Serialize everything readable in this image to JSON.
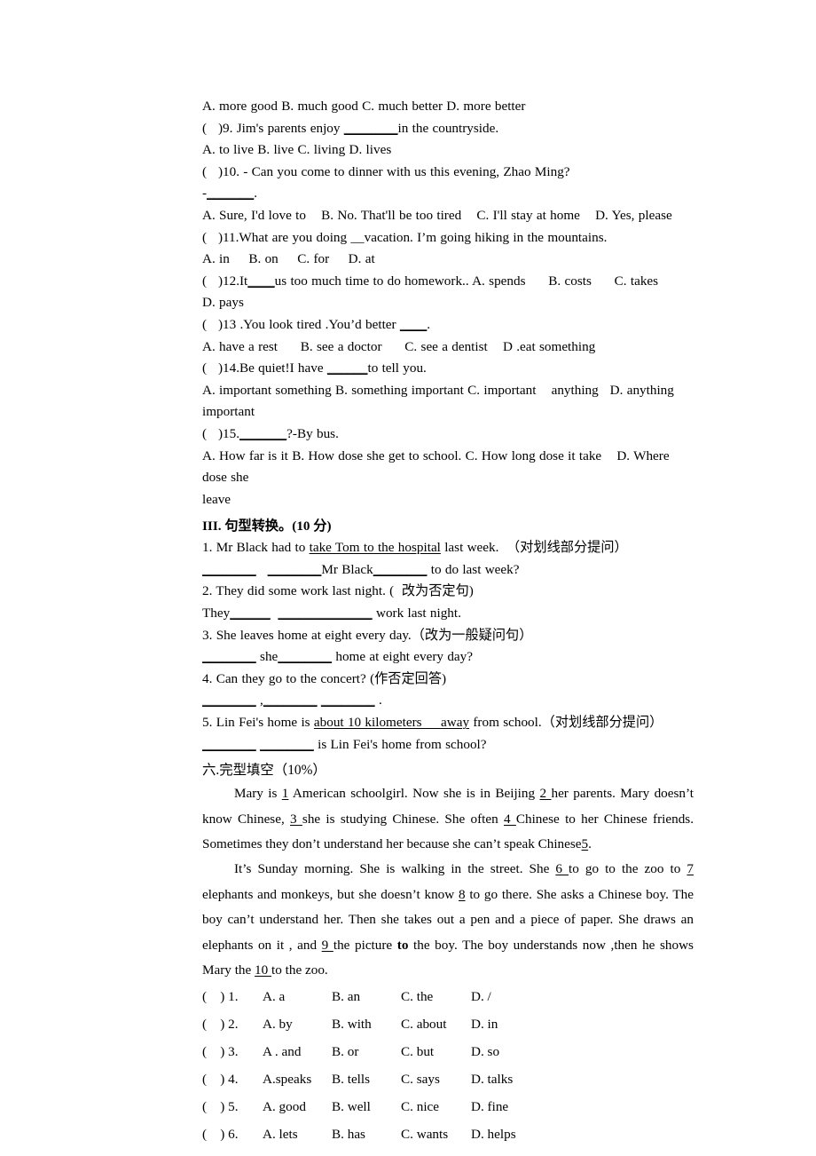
{
  "document": {
    "type": "english-exam-paper"
  },
  "multiple_choice": {
    "lines": [
      "A. more good B. much good C. much better D. more better",
      "(   )9. Jim's parents enjoy ",
      "in the countryside.",
      "A. to live B. live C. living D. lives",
      "(   )10. - Can you come to dinner with us this evening, Zhao Ming?",
      "-",
      ".",
      "A. Sure, I'd love to    B. No. That'll be too tired    C. I'll stay at home    D. Yes, please",
      "(   )11.What are you doing __vacation. I’m going hiking in the mountains.",
      "A. in     B. on     C. for     D. at",
      "(   )12.It",
      "us too much time to do homework.. A. spends      B. costs      C. takes      D. pays",
      "(   )13 .You look tired .You’d better ",
      ".",
      "A. have a rest      B. see a doctor      C. see a dentist    D .eat something",
      "(   )14.Be quiet!I have ",
      "to tell you.",
      "A. important something B. something important C. important    anything   D. anything important",
      "(   )15.",
      "?-By bus.",
      "A. How far is it B. How dose she get to school. C. How long dose it take    D. Where dose she",
      "leave"
    ],
    "q9": {
      "prefix": "(   )9. Jim's parents enjoy ",
      "blank": "________",
      "suffix": "in the countryside."
    },
    "q9_options": "A. to live B. live C. living D. lives",
    "q10": "(   )10. - Can you come to dinner with us this evening, Zhao Ming?",
    "q10_answer_line_prefix": "-",
    "q10_answer_line_blank": "_______",
    "q10_answer_line_suffix": ".",
    "q10_options": "A. Sure, I'd love to    B. No. That'll be too tired    C. I'll stay at home    D. Yes, please",
    "q11": "(   )11.What are you doing __vacation. I’m going hiking in the mountains.",
    "q11_options": "A. in     B. on     C. for     D. at",
    "q12_prefix": "(   )12.It",
    "q12_blank": "____",
    "q12_suffix": "us too much time to do homework.. A. spends      B. costs      C. takes      D. pays",
    "q13_prefix": "(   )13 .You look tired .You’d better ",
    "q13_blank": "____",
    "q13_suffix": ".",
    "q13_options": "A. have a rest      B. see a doctor      C. see a dentist    D .eat something",
    "q14_prefix": "(   )14.Be quiet!I have ",
    "q14_blank": "______",
    "q14_suffix": "to tell you.",
    "q14_options": "A. important something B. something important C. important    anything   D. anything important",
    "q15_prefix": "(   )15.",
    "q15_blank": "_______",
    "q15_suffix": "?-By bus.",
    "q15_options": "A. How far is it B. How dose she get to school. C. How long dose it take    D. Where dose she",
    "q15_options_wrap": "leave",
    "q8_options": "A. more good B. much good C. much better D. more better"
  },
  "section3": {
    "heading": "III. 句型转换。(10 分)",
    "q1": {
      "number": "1. Mr Black had to ",
      "underlined": "take Tom to the hospital",
      "rest": " last week.  （对划线部分提问）",
      "answer_blank1": "________",
      "answer_gap": "   ",
      "answer_blank2": "________",
      "answer_mid": "Mr Black",
      "answer_blank3": "________",
      "answer_tail": " to do last week?"
    },
    "q2": {
      "text": "2. They did some work last night. (  改为否定句)",
      "answer_prefix": "They",
      "answer_blank1": "______",
      "answer_gap": "  ",
      "answer_blank2": "______",
      "answer_blank3": "________",
      "answer_tail": " work last night."
    },
    "q3": {
      "text": "3. She leaves home at eight every day.（改为一般疑问句）",
      "answer_blank1": "________",
      "answer_mid": " she",
      "answer_blank2": "________",
      "answer_tail": " home at eight every day?"
    },
    "q4": {
      "text": "4. Can they go to the concert? (作否定回答)",
      "answer_blank1": "________",
      "answer_comma": " ,",
      "answer_blank2": "________",
      "answer_gap": " ",
      "answer_blank3": "________",
      "answer_tail": " ."
    },
    "q5": {
      "prefix": "5. Lin Fei's home is ",
      "underlined": "about 10 kilometers     away",
      "rest": " from school.（对划线部分提问）",
      "answer_blank1": "________",
      "answer_gap": " ",
      "answer_blank2": "________",
      "answer_tail": " is Lin Fei's home from school?"
    }
  },
  "section6": {
    "heading": "六.完型填空（10%）",
    "passage": [
      {
        "parts": [
          {
            "t": "Mary is ",
            "style": "plain"
          },
          {
            "t": "1",
            "style": "underline"
          },
          {
            "t": " American schoolgirl. Now she is in Beijing ",
            "style": "plain"
          },
          {
            "t": "2 ",
            "style": "underline"
          },
          {
            "t": "her parents. Mary doesn’t know Chinese, ",
            "style": "plain"
          },
          {
            "t": "3 ",
            "style": "underline"
          },
          {
            "t": "she is studying Chinese. She often   ",
            "style": "plain"
          },
          {
            "t": " 4 ",
            "style": "underline"
          },
          {
            "t": " Chinese to her Chinese friends. Sometimes they don’t understand her because she can’t speak Chinese",
            "style": "plain"
          },
          {
            "t": "5",
            "style": "underline"
          },
          {
            "t": ".",
            "style": "plain"
          }
        ]
      },
      {
        "parts": [
          {
            "t": "It’s Sunday morning. She is walking in the street. She ",
            "style": "plain"
          },
          {
            "t": "6 ",
            "style": "underline"
          },
          {
            "t": "to go to the zoo to ",
            "style": "plain"
          },
          {
            "t": "7 ",
            "style": "underline"
          },
          {
            "t": "elephants and monkeys, but she doesn’t know ",
            "style": "plain"
          },
          {
            "t": "8",
            "style": "underline"
          },
          {
            "t": " to go there. She asks a Chinese boy. The boy can’t understand her. Then she takes out a pen and a piece of paper. She draws an elephants on it , and ",
            "style": "plain"
          },
          {
            "t": "9 ",
            "style": "underline"
          },
          {
            "t": "the picture ",
            "style": "plain"
          },
          {
            "t": "to",
            "style": "bold"
          },
          {
            "t": " the boy. The boy understands now ,then he shows Mary the ",
            "style": "plain"
          },
          {
            "t": "10 ",
            "style": "underline"
          },
          {
            "t": "to the zoo.",
            "style": "plain"
          }
        ]
      }
    ],
    "options": [
      {
        "q": "(    ) 1.",
        "a": "A. a",
        "b": "B. an",
        "c": "C. the",
        "d": "D. /"
      },
      {
        "q": "(    ) 2.",
        "a": "A. by",
        "b": "B. with",
        "c": "C. about",
        "d": "D. in"
      },
      {
        "q": "(    ) 3.",
        "a": "A . and",
        "b": "B. or",
        "c": "C. but",
        "d": "D. so"
      },
      {
        "q": "(    ) 4.",
        "a": "A.speaks",
        "b": "B. tells",
        "c": "C. says",
        "d": "D. talks"
      },
      {
        "q": "(    ) 5.",
        "a": "A. good",
        "b": "B. well",
        "c": "C. nice",
        "d": "D. fine"
      },
      {
        "q": "(    ) 6.",
        "a": "A. lets",
        "b": "B. has",
        "c": "C. wants",
        "d": "D. helps"
      }
    ]
  },
  "colors": {
    "page_background": "#ffffff",
    "text": "#000000"
  }
}
